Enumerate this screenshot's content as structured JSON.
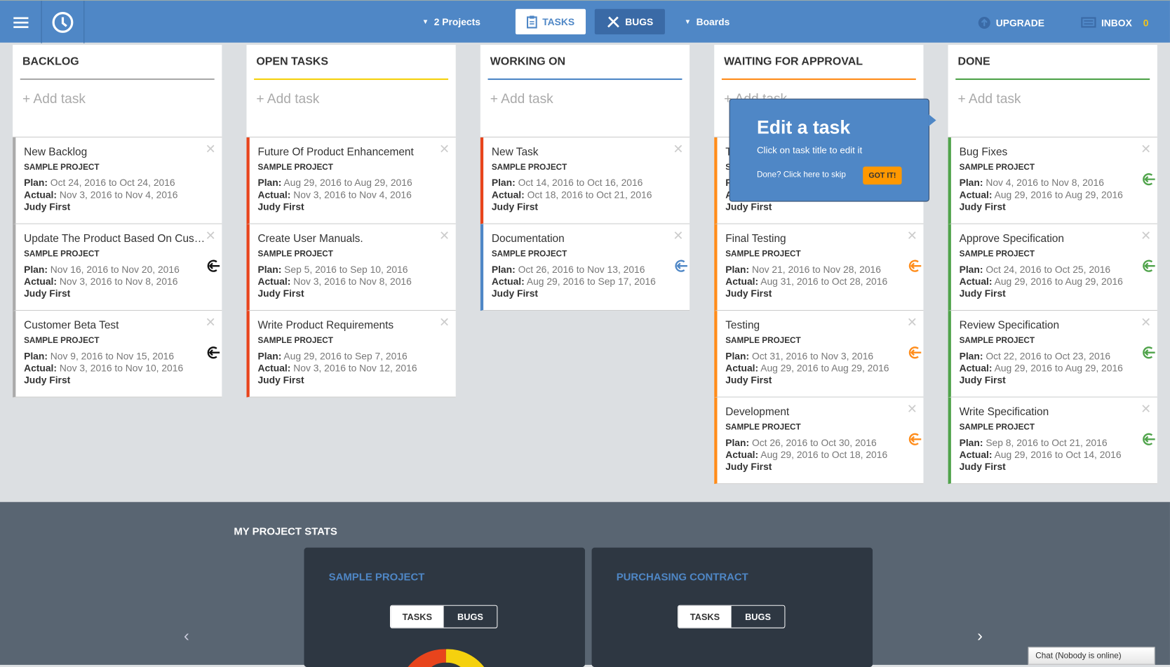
{
  "topbar": {
    "projects": "2 Projects",
    "tasks": "TASKS",
    "bugs": "BUGS",
    "boards": "Boards",
    "upgrade": "UPGRADE",
    "inbox": "INBOX",
    "inbox_count": "0"
  },
  "add_task": "+ Add task",
  "labels": {
    "plan": "Plan:",
    "actual": "Actual:"
  },
  "columns": [
    {
      "title": "BACKLOG",
      "color": "#aaaaaa",
      "cards": [
        {
          "title": "New Backlog",
          "project": "SAMPLE PROJECT",
          "plan": "Oct 24, 2016 to Oct 24, 2016",
          "actual": "Nov 3, 2016 to Nov 4, 2016",
          "assignee": "Judy First",
          "icon": ""
        },
        {
          "title": "Update The Product Based On Customer Feedback",
          "project": "SAMPLE PROJECT",
          "plan": "Nov 16, 2016 to Nov 20, 2016",
          "actual": "Nov 3, 2016 to Nov 8, 2016",
          "assignee": "Judy First",
          "icon": "#111111"
        },
        {
          "title": "Customer Beta Test",
          "project": "SAMPLE PROJECT",
          "plan": "Nov 9, 2016 to Nov 15, 2016",
          "actual": "Nov 3, 2016 to Nov 10, 2016",
          "assignee": "Judy First",
          "icon": "#111111"
        }
      ]
    },
    {
      "title": "OPEN TASKS",
      "color": "#f5d10e",
      "cards": [
        {
          "title": "Future Of Product Enhancement",
          "project": "SAMPLE PROJECT",
          "plan": "Aug 29, 2016 to Aug 29, 2016",
          "actual": "Nov 3, 2016 to Nov 4, 2016",
          "assignee": "Judy First",
          "icon": "",
          "border": "#e8441c"
        },
        {
          "title": "Create User Manuals.",
          "project": "SAMPLE PROJECT",
          "plan": "Sep 5, 2016 to Sep 10, 2016",
          "actual": "Nov 3, 2016 to Nov 8, 2016",
          "assignee": "Judy First",
          "icon": "",
          "border": "#e8441c"
        },
        {
          "title": "Write Product Requirements",
          "project": "SAMPLE PROJECT",
          "plan": "Aug 29, 2016 to Sep 7, 2016",
          "actual": "Nov 3, 2016 to Nov 12, 2016",
          "assignee": "Judy First",
          "icon": "",
          "border": "#e8441c"
        }
      ]
    },
    {
      "title": "WORKING ON",
      "color": "#4f87c6",
      "cards": [
        {
          "title": "New Task",
          "project": "SAMPLE PROJECT",
          "plan": "Oct 14, 2016 to Oct 16, 2016",
          "actual": "Oct 18, 2016 to Oct 21, 2016",
          "assignee": "Judy First",
          "icon": "",
          "border": "#e8441c"
        },
        {
          "title": "Documentation",
          "project": "SAMPLE PROJECT",
          "plan": "Oct 26, 2016 to Nov 13, 2016",
          "actual": "Aug 29, 2016 to Sep 17, 2016",
          "assignee": "Judy First",
          "icon": "#4f87c6",
          "border": "#4f87c6"
        }
      ]
    },
    {
      "title": "WAITING FOR APPROVAL",
      "color": "#ff8c1a",
      "cards": [
        {
          "title": "T",
          "project": "S",
          "plan": "",
          "actual": "",
          "assignee": "Judy First",
          "icon": "",
          "border": "#ff8c1a"
        },
        {
          "title": "Final Testing",
          "project": "SAMPLE PROJECT",
          "plan": "Nov 21, 2016 to Nov 28, 2016",
          "actual": "Aug 31, 2016 to Oct 28, 2016",
          "assignee": "Judy First",
          "icon": "#ff8c1a",
          "border": "#ff8c1a"
        },
        {
          "title": "Testing",
          "project": "SAMPLE PROJECT",
          "plan": "Oct 31, 2016 to Nov 3, 2016",
          "actual": "Aug 29, 2016 to Aug 29, 2016",
          "assignee": "Judy First",
          "icon": "#ff8c1a",
          "border": "#ff8c1a"
        },
        {
          "title": "Development",
          "project": "SAMPLE PROJECT",
          "plan": "Oct 26, 2016 to Oct 30, 2016",
          "actual": "Aug 29, 2016 to Oct 18, 2016",
          "assignee": "Judy First",
          "icon": "#ff8c1a",
          "border": "#ff8c1a"
        }
      ]
    },
    {
      "title": "DONE",
      "color": "#4fa34a",
      "cards": [
        {
          "title": "Bug Fixes",
          "project": "SAMPLE PROJECT",
          "plan": "Nov 4, 2016 to Nov 8, 2016",
          "actual": "Aug 29, 2016 to Aug 29, 2016",
          "assignee": "Judy First",
          "icon": "#4fa34a",
          "border": "#4fa34a"
        },
        {
          "title": "Approve Specification",
          "project": "SAMPLE PROJECT",
          "plan": "Oct 24, 2016 to Oct 25, 2016",
          "actual": "Aug 29, 2016 to Aug 29, 2016",
          "assignee": "Judy First",
          "icon": "#4fa34a",
          "border": "#4fa34a"
        },
        {
          "title": "Review Specification",
          "project": "SAMPLE PROJECT",
          "plan": "Oct 22, 2016 to Oct 23, 2016",
          "actual": "Aug 29, 2016 to Aug 29, 2016",
          "assignee": "Judy First",
          "icon": "#4fa34a",
          "border": "#4fa34a"
        },
        {
          "title": "Write Specification",
          "project": "SAMPLE PROJECT",
          "plan": "Sep 8, 2016 to Oct 21, 2016",
          "actual": "Aug 29, 2016 to Oct 14, 2016",
          "assignee": "Judy First",
          "icon": "#4fa34a",
          "border": "#4fa34a"
        }
      ]
    }
  ],
  "tooltip": {
    "title": "Edit a task",
    "subtitle": "Click on task title to edit it",
    "skip": "Done? Click here to skip",
    "got_it": "GOT IT!"
  },
  "stats": {
    "title": "MY PROJECT STATS",
    "panels": [
      {
        "title": "SAMPLE PROJECT",
        "tasks": "TASKS",
        "bugs": "BUGS"
      },
      {
        "title": "PURCHASING CONTRACT",
        "tasks": "TASKS",
        "bugs": "BUGS"
      }
    ]
  },
  "chat": "Chat (Nobody is online)"
}
